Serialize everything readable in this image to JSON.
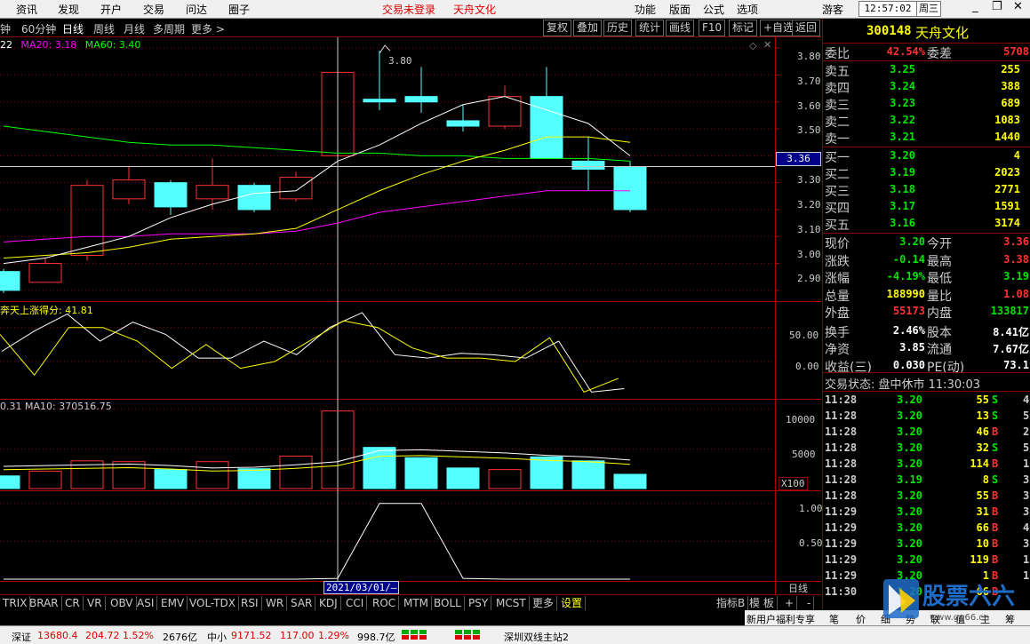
{
  "menu": [
    "资讯",
    "发现",
    "开户",
    "交易",
    "问达",
    "圈子"
  ],
  "menu_alert": "交易未登录",
  "menu_stock_name": "天舟文化",
  "menu_right": [
    "功能",
    "版面",
    "公式",
    "选项",
    "游客"
  ],
  "clock": "12:57:02",
  "weekday": "周三",
  "window_buttons": [
    "_",
    "❐",
    "✕"
  ],
  "periods": [
    "钟",
    "60分钟",
    "日线",
    "周线",
    "月线",
    "多周期",
    "更多 >"
  ],
  "toolbar_buttons": [
    "复权",
    "叠加",
    "历史",
    "统计",
    "画线",
    "F10",
    "标记",
    "+自选",
    "返回"
  ],
  "ma_legend": {
    "ma10": "22",
    "ma20": "MA20: 3.18",
    "ma60": "MA60: 3.40"
  },
  "indicator_legend": "奔天上涨得分: 41.81",
  "volume_legend": "0.31  MA10: 370516.75",
  "price_axis": [
    "3.80",
    "3.70",
    "3.60",
    "3.50",
    "3.30",
    "3.20",
    "3.10",
    "3.00",
    "2.90"
  ],
  "price_cursor": "3.36",
  "high_label": "3.80",
  "ind_axis": [
    "50.00",
    "0.00"
  ],
  "vol_axis": [
    "10000",
    "5000"
  ],
  "vol_unit": "X100",
  "low_axis": [
    "1.00",
    "0.50"
  ],
  "date_cursor": "2021/03/01/—",
  "period_label": "日线",
  "bottom_tabs": [
    "TRIX",
    "BRAR",
    "CR",
    "VR",
    "OBV",
    "ASI",
    "EMV",
    "VOL-TDX",
    "RSI",
    "WR",
    "SAR",
    "KDJ",
    "CCI",
    "ROC",
    "MTM",
    "BOLL",
    "PSY",
    "MCST",
    "更多",
    "设置"
  ],
  "bottom_right": [
    "指标B",
    "模 板",
    "+",
    "-"
  ],
  "promo": [
    "新用户福利专享",
    "笔",
    "价",
    "细",
    "势",
    "联",
    "值",
    "主",
    "筹"
  ],
  "quote": {
    "code": "300148",
    "name": "天舟文化",
    "webi_label": "委比",
    "webi": "42.54%",
    "weicha_label": "委差",
    "weicha": "5708",
    "asks": [
      {
        "label": "卖五",
        "price": "3.25",
        "vol": "255"
      },
      {
        "label": "卖四",
        "price": "3.24",
        "vol": "388"
      },
      {
        "label": "卖三",
        "price": "3.23",
        "vol": "689"
      },
      {
        "label": "卖二",
        "price": "3.22",
        "vol": "1083"
      },
      {
        "label": "卖一",
        "price": "3.21",
        "vol": "1440"
      }
    ],
    "bids": [
      {
        "label": "买一",
        "price": "3.20",
        "vol": "4"
      },
      {
        "label": "买二",
        "price": "3.19",
        "vol": "2023"
      },
      {
        "label": "买三",
        "price": "3.18",
        "vol": "2771"
      },
      {
        "label": "买四",
        "price": "3.17",
        "vol": "1591"
      },
      {
        "label": "买五",
        "price": "3.16",
        "vol": "3174"
      }
    ],
    "stats": [
      {
        "l1": "现价",
        "v1": "3.20",
        "c1": "dn",
        "l2": "今开",
        "v2": "3.36",
        "c2": "up"
      },
      {
        "l1": "涨跌",
        "v1": "-0.14",
        "c1": "dn",
        "l2": "最高",
        "v2": "3.38",
        "c2": "up"
      },
      {
        "l1": "涨幅",
        "v1": "-4.19%",
        "c1": "dn",
        "l2": "最低",
        "v2": "3.19",
        "c2": "dn"
      },
      {
        "l1": "总量",
        "v1": "188990",
        "c1": "yl",
        "l2": "量比",
        "v2": "1.08",
        "c2": "up"
      },
      {
        "l1": "外盘",
        "v1": "55173",
        "c1": "up",
        "l2": "内盘",
        "v2": "133817",
        "c2": "dn"
      },
      {
        "l1": "换手",
        "v1": "2.46%",
        "c1": "wh",
        "l2": "股本",
        "v2": "8.41亿",
        "c2": "wh"
      },
      {
        "l1": "净资",
        "v1": "3.85",
        "c1": "wh",
        "l2": "流通",
        "v2": "7.67亿",
        "c2": "wh"
      },
      {
        "l1": "收益(三)",
        "v1": "0.030",
        "c1": "wh",
        "l2": "PE(动)",
        "v2": "73.1",
        "c2": "wh"
      }
    ],
    "trade_status": "交易状态: 盘中休市 11:30:03",
    "ticks": [
      {
        "t": "11:28",
        "p": "3.20",
        "v": "55",
        "d": "S",
        "n": "4"
      },
      {
        "t": "11:28",
        "p": "3.20",
        "v": "13",
        "d": "S",
        "n": "5"
      },
      {
        "t": "11:28",
        "p": "3.20",
        "v": "46",
        "d": "B",
        "n": "2"
      },
      {
        "t": "11:28",
        "p": "3.20",
        "v": "32",
        "d": "S",
        "n": "5"
      },
      {
        "t": "11:28",
        "p": "3.20",
        "v": "114",
        "d": "B",
        "n": "1"
      },
      {
        "t": "11:28",
        "p": "3.19",
        "v": "8",
        "d": "S",
        "n": "3"
      },
      {
        "t": "11:28",
        "p": "3.20",
        "v": "55",
        "d": "B",
        "n": "3"
      },
      {
        "t": "11:29",
        "p": "3.20",
        "v": "31",
        "d": "B",
        "n": "3"
      },
      {
        "t": "11:29",
        "p": "3.20",
        "v": "66",
        "d": "B",
        "n": "4"
      },
      {
        "t": "11:29",
        "p": "3.20",
        "v": "10",
        "d": "B",
        "n": "3"
      },
      {
        "t": "11:29",
        "p": "3.20",
        "v": "119",
        "d": "B",
        "n": "1"
      },
      {
        "t": "11:29",
        "p": "3.20",
        "v": "1",
        "d": "B",
        "n": "1"
      },
      {
        "t": "11:30",
        "p": "3.20",
        "v": "66",
        "d": "B",
        "n": ""
      }
    ]
  },
  "status": {
    "sz_name": "深证",
    "sz_val": "13680.4",
    "sz_chg": "204.72",
    "sz_pct": "1.52%",
    "sz_amt": "2676亿",
    "zx_name": "中小",
    "zx_val": "9171.52",
    "zx_chg": "117.00",
    "zx_pct": "1.29%",
    "zx_amt": "998.7亿",
    "server": "深圳双线主站2"
  },
  "watermark": "股票六六",
  "watermark_url": "www.gp66.cn",
  "colors": {
    "up": "#ff3232",
    "down": "#54ffff",
    "ma5": "#ffffff",
    "ma10": "#ffff00",
    "ma20": "#ff00ff",
    "ma60": "#00ff00",
    "grid": "#800000"
  },
  "chart_data": {
    "type": "candlestick",
    "candles": [
      {
        "o": 2.97,
        "c": 2.9,
        "h": 2.98,
        "l": 2.89
      },
      {
        "o": 2.93,
        "c": 3.0,
        "h": 3.02,
        "l": 2.93
      },
      {
        "o": 3.03,
        "c": 3.29,
        "h": 3.31,
        "l": 3.01
      },
      {
        "o": 3.24,
        "c": 3.31,
        "h": 3.36,
        "l": 3.22
      },
      {
        "o": 3.3,
        "c": 3.21,
        "h": 3.31,
        "l": 3.18
      },
      {
        "o": 3.24,
        "c": 3.29,
        "h": 3.39,
        "l": 3.2
      },
      {
        "o": 3.29,
        "c": 3.2,
        "h": 3.3,
        "l": 3.19
      },
      {
        "o": 3.24,
        "c": 3.32,
        "h": 3.34,
        "l": 3.23
      },
      {
        "o": 3.4,
        "c": 3.71,
        "h": 3.8,
        "l": 3.33
      },
      {
        "o": 3.61,
        "c": 3.6,
        "h": 3.79,
        "l": 3.57
      },
      {
        "o": 3.62,
        "c": 3.6,
        "h": 3.73,
        "l": 3.56
      },
      {
        "o": 3.53,
        "c": 3.51,
        "h": 3.59,
        "l": 3.49
      },
      {
        "o": 3.51,
        "c": 3.62,
        "h": 3.66,
        "l": 3.5
      },
      {
        "o": 3.62,
        "c": 3.39,
        "h": 3.73,
        "l": 3.39
      },
      {
        "o": 3.38,
        "c": 3.35,
        "h": 3.47,
        "l": 3.27
      },
      {
        "o": 3.36,
        "c": 3.2,
        "h": 3.38,
        "l": 3.19
      }
    ],
    "ma5": [
      3.0,
      3.02,
      3.06,
      3.1,
      3.17,
      3.22,
      3.26,
      3.27,
      3.38,
      3.44,
      3.52,
      3.59,
      3.62,
      3.57,
      3.52,
      3.4
    ],
    "ma10": [
      3.02,
      3.03,
      3.04,
      3.06,
      3.09,
      3.1,
      3.11,
      3.13,
      3.2,
      3.27,
      3.33,
      3.38,
      3.42,
      3.47,
      3.47,
      3.45
    ],
    "ma20": [
      3.08,
      3.09,
      3.1,
      3.1,
      3.11,
      3.11,
      3.11,
      3.12,
      3.15,
      3.19,
      3.21,
      3.23,
      3.25,
      3.27,
      3.27,
      3.27
    ],
    "ma60": [
      3.51,
      3.49,
      3.47,
      3.45,
      3.44,
      3.44,
      3.43,
      3.42,
      3.41,
      3.41,
      3.4,
      3.4,
      3.39,
      3.39,
      3.39,
      3.38
    ],
    "y_range": [
      2.86,
      3.84
    ],
    "score": [
      15,
      45,
      70,
      30,
      58,
      40,
      5,
      5,
      30,
      10,
      50,
      72,
      10,
      5,
      12,
      10,
      5,
      30,
      -45,
      -40
    ],
    "score_ma": [
      40,
      -20,
      50,
      50,
      30,
      -10,
      25,
      -10,
      0,
      30,
      60,
      50,
      20,
      5,
      5,
      0,
      35,
      -45,
      -25
    ],
    "volume": [
      1600,
      2200,
      3500,
      3400,
      2400,
      3400,
      2500,
      4100,
      9800,
      5200,
      3900,
      2600,
      2400,
      4000,
      3500,
      1800
    ],
    "vol_ma": [
      2800,
      2900,
      3000,
      3100,
      2900,
      2600,
      2700,
      3000,
      3400,
      4800,
      4900,
      4700,
      4500,
      4200,
      4000,
      3600
    ],
    "vol_range": [
      0,
      11000
    ],
    "signal": [
      0,
      0,
      0,
      0,
      0,
      0,
      0,
      0,
      0.01,
      1,
      1,
      0.01,
      0,
      0,
      0,
      0
    ],
    "signal_range": [
      0,
      1.15
    ]
  }
}
